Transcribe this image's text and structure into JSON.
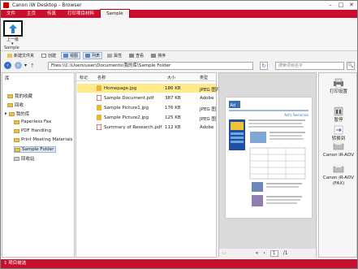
{
  "window": {
    "title": "Canon iW Desktop - Browser"
  },
  "menu": {
    "items": [
      "文件",
      "主页",
      "传真",
      "打印项目材料",
      "Sample"
    ]
  },
  "ribbon": {
    "up_label": "上一级",
    "group_label": "Sample"
  },
  "toolbar": {
    "items": [
      "新建文件夹",
      "创建",
      "视图",
      "列表",
      "属性",
      "查看",
      "排序"
    ]
  },
  "address": {
    "path": "Files:\\\\C:\\Users\\user\\Documents\\我的库\\Sample Folder",
    "search_placeholder": "搜索项目名字"
  },
  "tree": {
    "header": "库",
    "items": [
      "我的收藏",
      "回收",
      "我的库",
      "Paperless Fax",
      "PDF Handling",
      "Print Meeting Materials",
      "Sample Folder",
      "回收站"
    ]
  },
  "list": {
    "columns": [
      "标记",
      "名称",
      "大小",
      "类型"
    ],
    "rows": [
      {
        "name": "Homepage.jpg",
        "size": "186 KB",
        "type": "JPEG 图片"
      },
      {
        "name": "Sample Document.pdf",
        "size": "387 KB",
        "type": "Adobe"
      },
      {
        "name": "Sample Picture1.jpg",
        "size": "176 KB",
        "type": "JPEG 图"
      },
      {
        "name": "Sample Picture2.jpg",
        "size": "125 KB",
        "type": "JPEG 图"
      },
      {
        "name": "Summary of Research.pdf",
        "size": "112 KB",
        "type": "Adobe"
      }
    ]
  },
  "preview": {
    "header_text": "Ad's Services",
    "page_number": "1",
    "page_total": "/1"
  },
  "actions": {
    "items": [
      "打印设置",
      "暂停",
      "转换到",
      "Canon iR-ADV",
      "Canon iR-ADV (FAX)"
    ]
  },
  "status": {
    "text": "1 项目被选"
  },
  "colors": {
    "brand": "#c8102e",
    "selection": "#ffe98a"
  }
}
